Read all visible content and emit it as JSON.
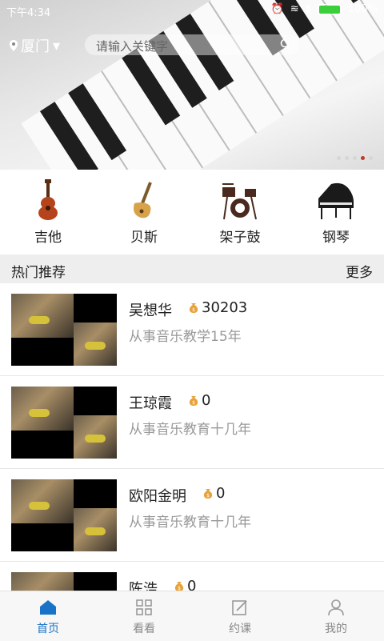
{
  "status_bar": {
    "time": "下午4:34",
    "battery": "100%"
  },
  "header": {
    "city": "厦门",
    "search_placeholder": "请输入关键字"
  },
  "banner": {
    "dots": 5,
    "active_dot": 4
  },
  "categories": [
    {
      "label": "吉他",
      "icon": "guitar-icon"
    },
    {
      "label": "贝斯",
      "icon": "bass-icon"
    },
    {
      "label": "架子鼓",
      "icon": "drum-kit-icon"
    },
    {
      "label": "钢琴",
      "icon": "piano-icon"
    }
  ],
  "section": {
    "title": "热门推荐",
    "more": "更多"
  },
  "teachers": [
    {
      "name": "吴想华",
      "count": "30203",
      "desc": "从事音乐教学15年"
    },
    {
      "name": "王琼霞",
      "count": "0",
      "desc": "从事音乐教育十几年"
    },
    {
      "name": "欧阳金明",
      "count": "0",
      "desc": "从事音乐教育十几年"
    },
    {
      "name": "陈浩",
      "count": "0",
      "desc": ""
    }
  ],
  "tabs": [
    {
      "label": "首页",
      "active": true
    },
    {
      "label": "看看",
      "active": false
    },
    {
      "label": "约课",
      "active": false
    },
    {
      "label": "我的",
      "active": false
    }
  ],
  "colors": {
    "accent": "#1a73c7",
    "brand_dot": "#c0392b",
    "coin": "#e8a23a"
  }
}
